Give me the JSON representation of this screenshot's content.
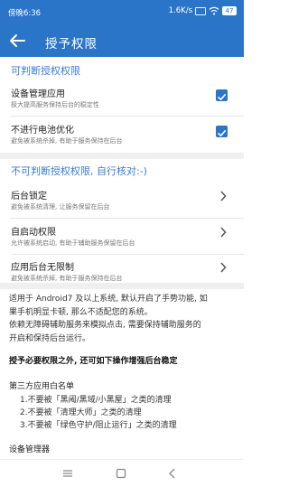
{
  "status": {
    "time": "傍晚6:36",
    "speed": "1.6K/s",
    "battery": "47"
  },
  "toolbar": {
    "title": "授予权限"
  },
  "sec1": {
    "title": "可判断授权权限",
    "items": [
      {
        "label": "设备管理应用",
        "sub": "极大提高服务保持后台的稳定性",
        "checked": true
      },
      {
        "label": "不进行电池优化",
        "sub": "避免被系统杀掉, 有助于服务保持在后台",
        "checked": true
      }
    ]
  },
  "sec2": {
    "title": "不可判断授权权限, 自行核对:-)",
    "items": [
      {
        "label": "后台锁定",
        "sub": "避免被系统清理, 让服务保留在后台"
      },
      {
        "label": "自启动权限",
        "sub": "允许被系统启动, 有助于辅助服务保留在后台"
      },
      {
        "label": "应用后台无限制",
        "sub": "避免被系统杀掉, 有助于服务保持在后台"
      }
    ]
  },
  "info": {
    "line1": "适用于 Android7 及以上系统, 默认开启了手势功能, 如",
    "line2": "果手机明显卡顿, 那么不适配您的系统。",
    "line3": "依赖无障碍辅助服务来模拟点击, 需要保持辅助服务的",
    "line4": "开启和保持后台运行。"
  },
  "extra": {
    "heading": "授予必要权限之外, 还可如下操作增强后台稳定"
  },
  "whitelist": {
    "title": "第三方应用白名单",
    "items": [
      "1.不要被「黑阈/黑域/小黑屋」之类的清理",
      "2.不要被「清理大师」之类的清理",
      "3.不要被「绿色守护/阻止运行」之类的清理"
    ]
  },
  "device_admin": {
    "title": "设备管理器"
  }
}
